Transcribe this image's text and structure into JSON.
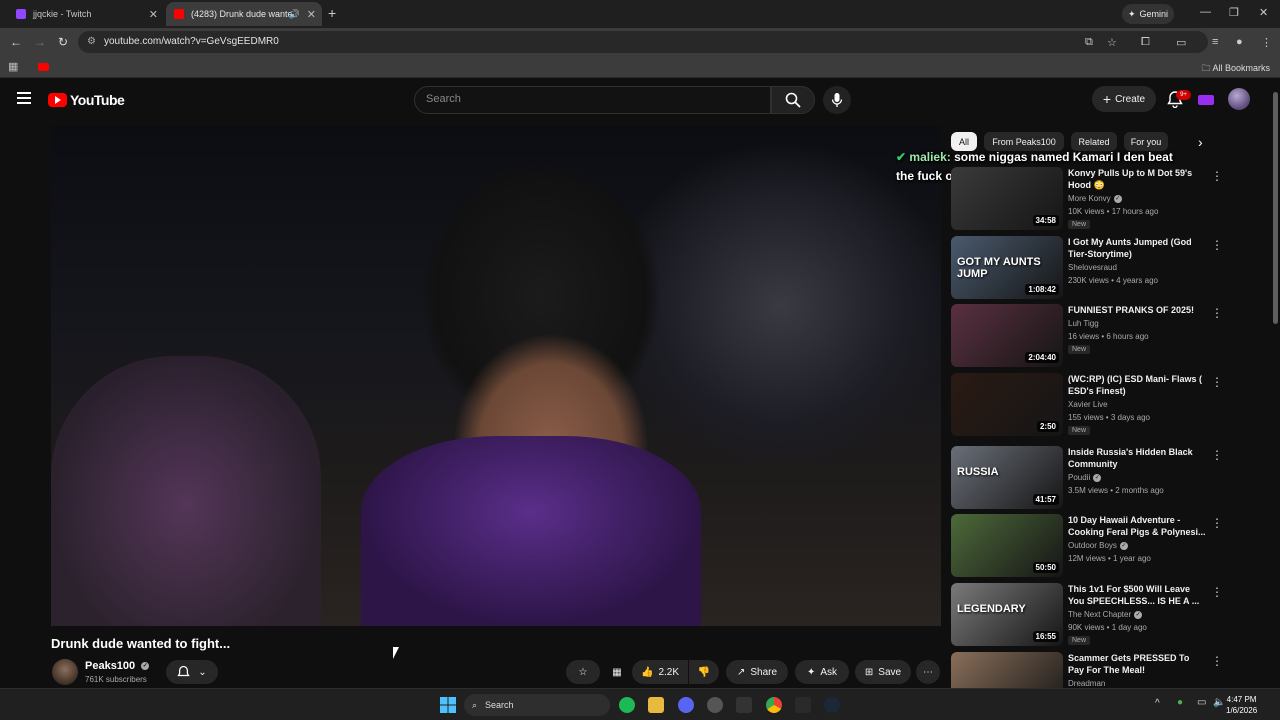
{
  "browser": {
    "tabs": [
      {
        "title": "jjqckie - Twitch",
        "favicon_color": "#9146ff"
      },
      {
        "title": "(4283) Drunk dude wanted",
        "favicon_color": "#ff0000"
      }
    ],
    "gemini_label": "Gemini",
    "url": "youtube.com/watch?v=GeVsgEEDMR0",
    "all_bookmarks": "All Bookmarks"
  },
  "youtube": {
    "logo_text": "YouTube",
    "search_placeholder": "Search",
    "create_label": "Create",
    "notifications_badge": "9+"
  },
  "video": {
    "title": "Drunk dude wanted to fight...",
    "overlay_chat": {
      "user": "maliek:",
      "message": "some niggas named Kamari I den beat the fuck out of"
    },
    "channel": {
      "name": "Peaks100",
      "subscribers": "761K subscribers"
    },
    "actions": {
      "likes": "2.2K",
      "share": "Share",
      "ask": "Ask",
      "save": "Save"
    }
  },
  "chips": [
    "All",
    "From Peaks100",
    "Related",
    "For you"
  ],
  "recommendations": [
    {
      "title": "Konvy Pulls Up to M Dot 59's Hood 😳",
      "channel": "More Konvy",
      "verified": true,
      "meta": "10K views • 17 hours ago",
      "new": "New",
      "duration": "34:58",
      "thumb": "#3a3a3a"
    },
    {
      "title": "I Got My Aunts Jumped (God Tier-Storytime)",
      "channel": "Shelovesraud",
      "verified": false,
      "meta": "230K views • 4 years ago",
      "new": "",
      "duration": "1:08:42",
      "thumb": "#4a5a6e",
      "thumb_text": "GOT MY AUNTS JUMP"
    },
    {
      "title": "FUNNIEST PRANKS OF 2025!",
      "channel": "Luh Tigg",
      "verified": false,
      "meta": "16 views • 6 hours ago",
      "new": "New",
      "duration": "2:04:40",
      "thumb": "#5a3040"
    },
    {
      "title": "(WC:RP) (IC) ESD Mani- Flaws ( ESD's Finest)",
      "channel": "Xavier Live",
      "verified": false,
      "meta": "155 views • 3 days ago",
      "new": "New",
      "duration": "2:50",
      "thumb": "#2a1a14"
    },
    {
      "title": "Inside Russia's Hidden Black Community",
      "channel": "Poudii",
      "verified": true,
      "meta": "3.5M views • 2 months ago",
      "new": "",
      "duration": "41:57",
      "thumb": "#6a6f78",
      "thumb_text": "RUSSIA"
    },
    {
      "title": "10 Day Hawaii Adventure - Cooking Feral Pigs & Polynesi...",
      "channel": "Outdoor Boys",
      "verified": true,
      "meta": "12M views • 1 year ago",
      "new": "",
      "duration": "50:50",
      "thumb": "#4d6a3a"
    },
    {
      "title": "This 1v1 For $500 Will Leave You SPEECHLESS... IS HE A ...",
      "channel": "The Next Chapter",
      "verified": true,
      "meta": "90K views • 1 day ago",
      "new": "New",
      "duration": "16:55",
      "thumb": "#7a7a7a",
      "thumb_text": "LEGENDARY"
    },
    {
      "title": "Scammer Gets PRESSED To Pay For The Meal!",
      "channel": "Dreadman",
      "verified": false,
      "meta": "",
      "new": "",
      "duration": "",
      "thumb": "#8a6f5a"
    }
  ],
  "taskbar": {
    "search_label": "Search",
    "time": "4:47 PM",
    "date": "1/6/2026"
  }
}
